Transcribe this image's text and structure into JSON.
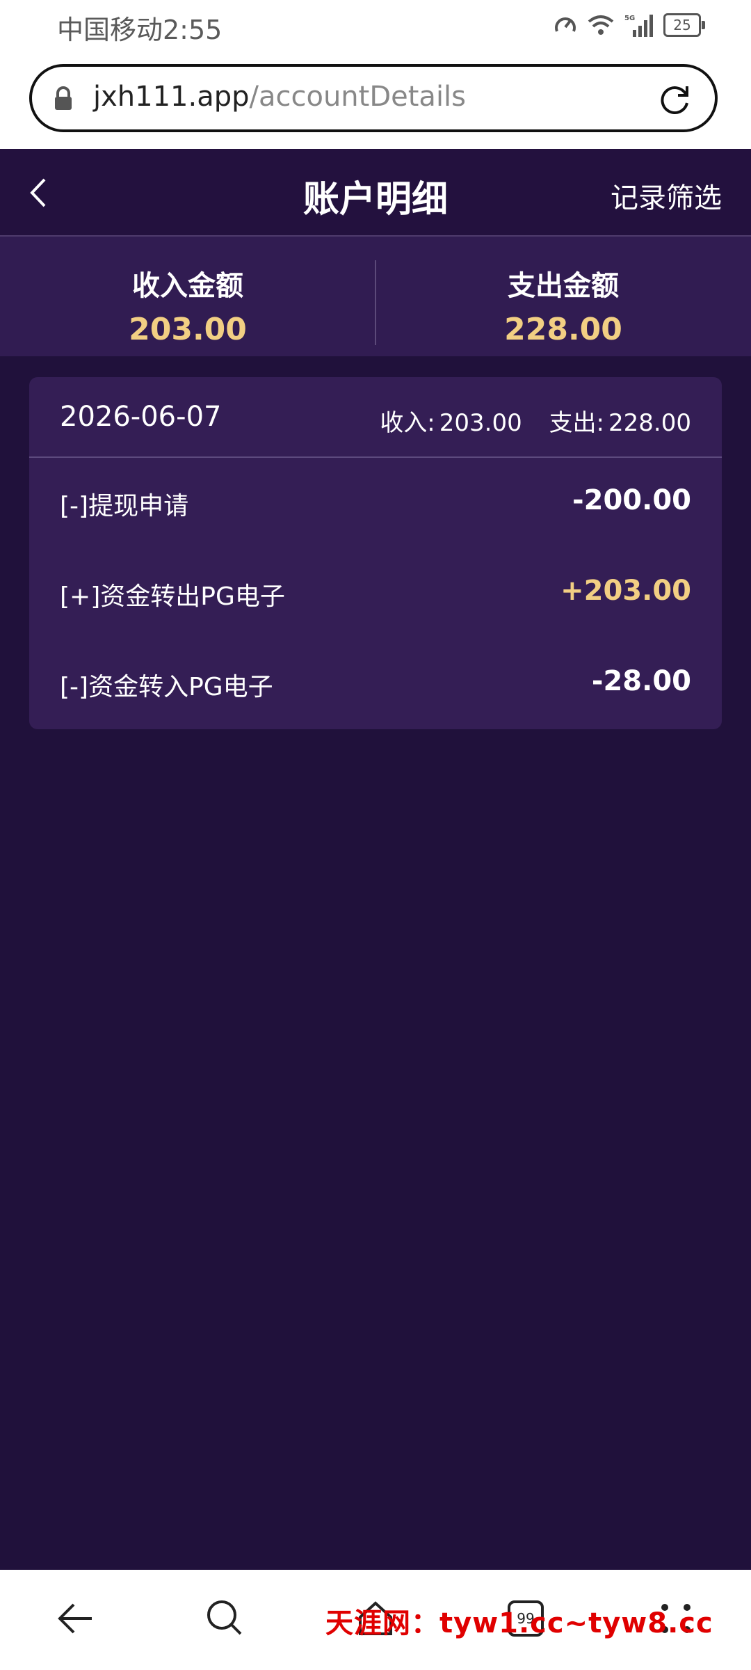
{
  "status_bar": {
    "carrier_time": "中国移动2:55",
    "battery": "25",
    "network": "5G"
  },
  "browser": {
    "url_host": "jxh111.app",
    "url_path": "/accountDetails"
  },
  "header": {
    "title": "账户明细",
    "filter_label": "记录筛选"
  },
  "summary": {
    "income_label": "收入金额",
    "income_value": "203.00",
    "expense_label": "支出金额",
    "expense_value": "228.00"
  },
  "day_group": {
    "date": "2026-06-07",
    "income_label": "收入:",
    "income_value": "203.00",
    "expense_label": "支出:",
    "expense_value": "228.00",
    "rows": [
      {
        "label": "[-]提现申请",
        "amount": "-200.00"
      },
      {
        "label": "[+]资金转出PG电子",
        "amount": "+203.00"
      },
      {
        "label": "[-]资金转入PG电子",
        "amount": "-28.00"
      }
    ]
  },
  "watermark": "天涯网：tyw1.cc~tyw8.cc",
  "colors": {
    "background": "#20113b",
    "accent": "#f2cf83",
    "card": "#341e55"
  }
}
